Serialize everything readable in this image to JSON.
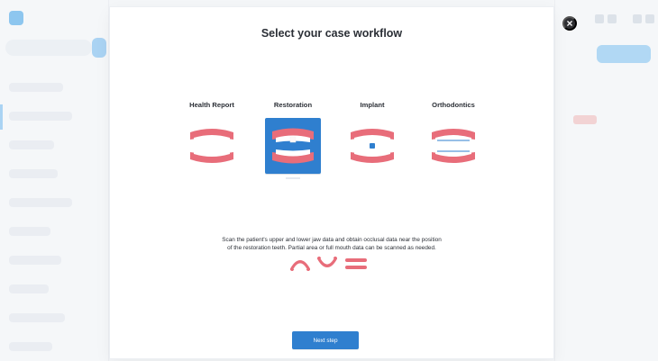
{
  "modal": {
    "title": "Select your case workflow",
    "close_icon": "close-icon",
    "options": [
      {
        "label": "Health Report",
        "icon": "health-report-teeth-icon",
        "selected": false
      },
      {
        "label": "Restoration",
        "icon": "restoration-teeth-icon",
        "selected": true
      },
      {
        "label": "Implant",
        "icon": "implant-teeth-icon",
        "selected": false
      },
      {
        "label": "Orthodontics",
        "icon": "orthodontics-teeth-icon",
        "selected": false
      }
    ],
    "description": {
      "line1": "Scan the patient's upper and lower jaw data and obtain occlusal data near the position",
      "line2": "of the restoration teeth. Partial area or full mouth data can be scanned as needed."
    },
    "jaw_icons": [
      "upper-jaw-icon",
      "lower-jaw-icon",
      "occlusion-icon"
    ],
    "next_label": "Next step"
  },
  "colors": {
    "accent": "#2f7fcf",
    "gum": "#e86d7a",
    "tooth": "#ffffff"
  }
}
